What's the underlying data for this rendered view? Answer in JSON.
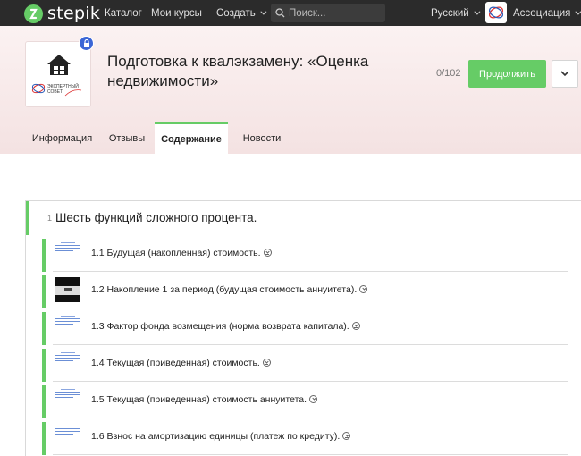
{
  "nav": {
    "brand": "stepik",
    "catalog": "Каталог",
    "my_courses": "Мои курсы",
    "create": "Создать",
    "search_placeholder": "Поиск...",
    "language": "Русский",
    "user": "Ассоциация"
  },
  "course": {
    "title": "Подготовка к квалэкзамену: «Оценка недвижимости»",
    "progress": "0/102",
    "continue_label": "Продолжить",
    "cover_logo_text": "ЭКСПЕРТНЫЙ СОВЕТ",
    "tabs": [
      {
        "label": "Информация"
      },
      {
        "label": "Отзывы"
      },
      {
        "label": "Содержание"
      },
      {
        "label": "Новости"
      }
    ],
    "active_tab": "Содержание"
  },
  "module": {
    "number": "1",
    "title": "Шесть функций сложного процента.",
    "lessons": [
      {
        "title": "1.1 Будущая (накопленная) стоимость.",
        "thumb": "doc"
      },
      {
        "title": "1.2 Накопление 1 за период (будущая стоимость аннуитета).",
        "thumb": "dark"
      },
      {
        "title": "1.3 Фактор фонда возмещения (норма возврата капитала).",
        "thumb": "doc"
      },
      {
        "title": "1.4 Текущая (приведенная) стоимость.",
        "thumb": "doc"
      },
      {
        "title": "1.5 Текущая (приведенная) стоимость аннуитета.",
        "thumb": "doc"
      },
      {
        "title": "1.6 Взнос на амортизацию единицы (платеж по кредиту).",
        "thumb": "doc"
      }
    ]
  },
  "colors": {
    "accent": "#66cc66",
    "topbar": "#2b2b2b",
    "header_bg": "#f6e7e7",
    "lock": "#3b66d6"
  }
}
